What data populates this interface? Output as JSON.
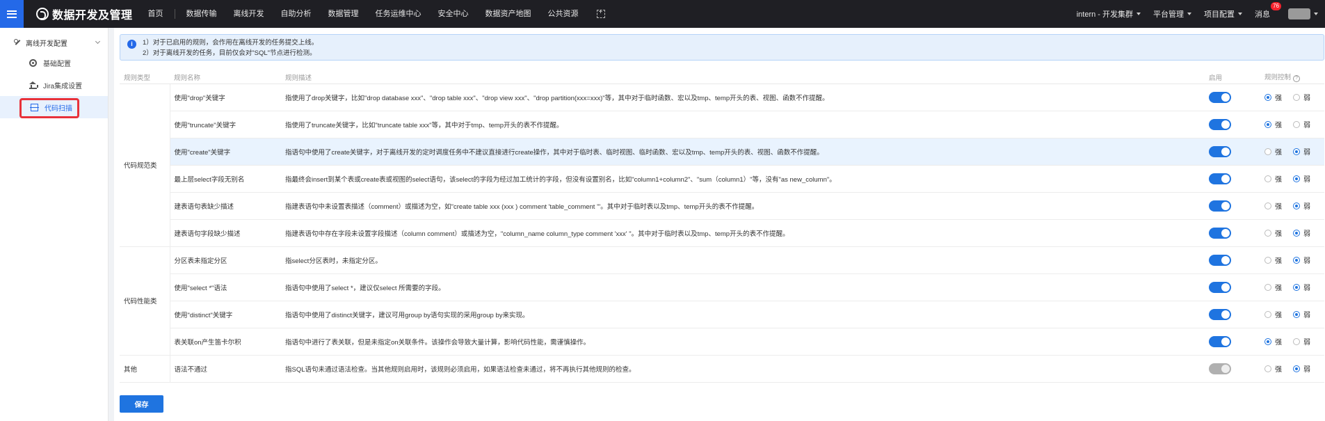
{
  "topbar": {
    "brand_title": "数据开发及管理",
    "nav_items": [
      "首页",
      "数据传输",
      "离线开发",
      "自助分析",
      "数据管理",
      "任务运维中心",
      "安全中心",
      "数据资产地图",
      "公共资源"
    ],
    "cluster": "intern - 开发集群",
    "platform": "平台管理",
    "project_config": "项目配置",
    "messages": "消息",
    "message_count": "76"
  },
  "sidebar": {
    "group": "离线开发配置",
    "items": [
      "基础配置",
      "Jira集成设置",
      "代码扫描"
    ],
    "active_index": 2
  },
  "notice": {
    "line1": "1）对于已启用的规则，会作用在离线开发的任务提交上线。",
    "line2": "2）对于离线开发的任务，目前仅会对\"SQL\"节点进行检测。"
  },
  "table": {
    "headers": [
      "规则类型",
      "规则名称",
      "规则描述",
      "启用",
      "规则控制"
    ],
    "strong_label": "强",
    "weak_label": "弱",
    "categories": [
      "代码规范类",
      "代码性能类",
      "其他"
    ],
    "rows": [
      {
        "name": "使用\"drop\"关键字",
        "desc": "指使用了drop关键字，比如\"drop database xxx\"、\"drop table xxx\"、\"drop view xxx\"、\"drop partition(xxx=xxx)\"等，其中对于临时函数、宏以及tmp、temp开头的表、视图、函数不作提醒。",
        "enabled": true,
        "control": "strong"
      },
      {
        "name": "使用\"truncate\"关键字",
        "desc": "指使用了truncate关键字，比如\"truncate table xxx\"等，其中对于tmp、temp开头的表不作提醒。",
        "enabled": true,
        "control": "strong"
      },
      {
        "name": "使用\"create\"关键字",
        "desc": "指语句中使用了create关键字，对于离线开发的定时调度任务中不建议直接进行create操作，其中对于临时表、临时视图、临时函数、宏以及tmp、temp开头的表、视图、函数不作提醒。",
        "enabled": true,
        "control": "weak"
      },
      {
        "name": "最上层select字段无别名",
        "desc": "指最终会insert到某个表或create表或视图的select语句，该select的字段为经过加工统计的字段，但没有设置别名，比如\"column1+column2\"、\"sum（column1）\"等，没有\"as new_column\"。",
        "enabled": true,
        "control": "weak"
      },
      {
        "name": "建表语句表缺少描述",
        "desc": "指建表语句中未设置表描述（comment）或描述为空，如\"create table xxx (xxx ) comment 'table_comment '\"。其中对于临时表以及tmp、temp开头的表不作提醒。",
        "enabled": true,
        "control": "weak"
      },
      {
        "name": "建表语句字段缺少描述",
        "desc": "指建表语句中存在字段未设置字段描述（column comment）或描述为空，\"column_name column_type comment 'xxx' \"。其中对于临时表以及tmp、temp开头的表不作提醒。",
        "enabled": true,
        "control": "weak"
      },
      {
        "name": "分区表未指定分区",
        "desc": "指select分区表时，未指定分区。",
        "enabled": true,
        "control": "weak"
      },
      {
        "name": "使用\"select *\"语法",
        "desc": "指语句中使用了select *，建议仅select 所需要的字段。",
        "enabled": true,
        "control": "weak"
      },
      {
        "name": "使用\"distinct\"关键字",
        "desc": "指语句中使用了distinct关键字，建议可用group by语句实现的采用group by来实现。",
        "enabled": true,
        "control": "weak"
      },
      {
        "name": "表关联on产生笛卡尔积",
        "desc": "指语句中进行了表关联，但是未指定on关联条件。该操作会导致大量计算，影响代码性能，需谨慎操作。",
        "enabled": true,
        "control": "strong"
      },
      {
        "name": "语法不通过",
        "desc": "指SQL语句未通过语法检查。当其他规则启用时，该规则必须启用，如果语法检查未通过，将不再执行其他规则的检查。",
        "enabled": "disabled",
        "control": "weak"
      }
    ]
  },
  "save_label": "保存",
  "colors": {
    "primary": "#1f74e0",
    "topbar": "#1f1f24",
    "highlight": "#e8313a"
  }
}
